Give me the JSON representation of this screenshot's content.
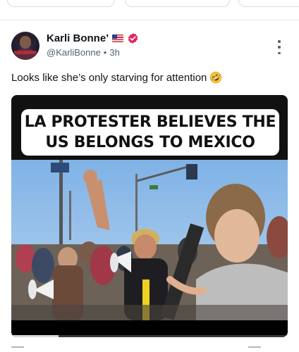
{
  "post": {
    "author_name": "Karli Bonne’",
    "author_handle": "@KarliBonne",
    "separator": "•",
    "time": "3h",
    "text": "Looks like she’s only starving for attention",
    "flag_icon": "us-flag-icon",
    "verified_icon": "verified-badge-icon",
    "emoji_icon": "rolling-on-floor-laughing-emoji"
  },
  "media": {
    "caption_line1": "LA PROTESTER BELIEVES THE",
    "caption_line2": "US BELONGS TO MEXICO",
    "progress": 0.17
  },
  "colors": {
    "verified": "#e0245e",
    "handle": "#536471",
    "text": "#0f1419"
  }
}
